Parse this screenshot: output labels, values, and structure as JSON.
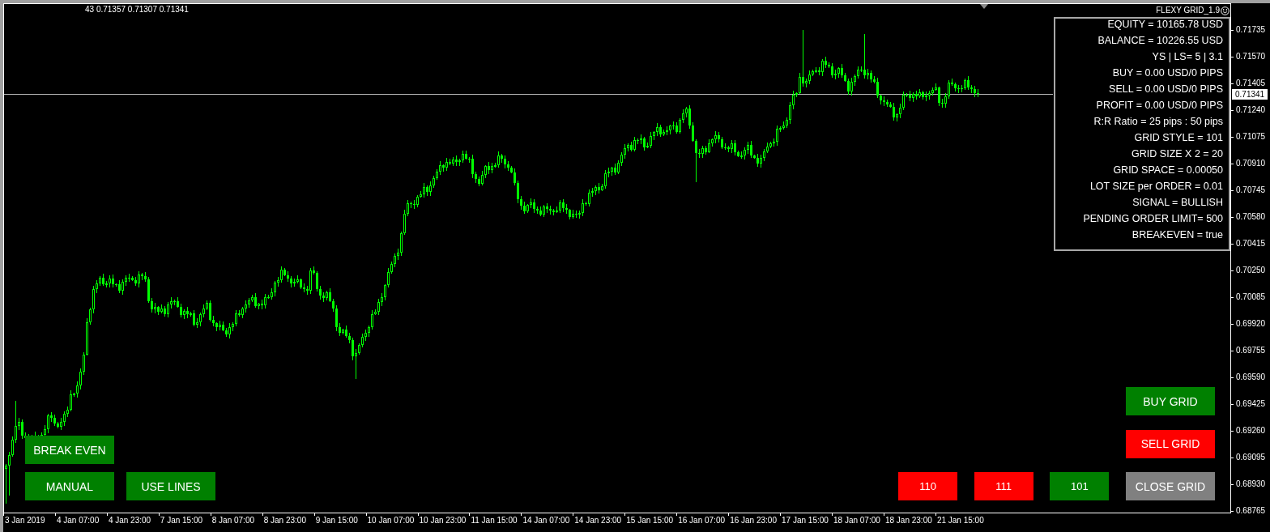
{
  "chart": {
    "ohlc_text": "43 0.71357 0.71307 0.71341",
    "expert_label": "FLEXY GRID_1.9",
    "current_price": "0.71341",
    "price_axis": [
      "0.71735",
      "0.71570",
      "0.71405",
      "0.71240",
      "0.71075",
      "0.70910",
      "0.70745",
      "0.70580",
      "0.70415",
      "0.70250",
      "0.70085",
      "0.69920",
      "0.69755",
      "0.69590",
      "0.69425",
      "0.69260",
      "0.69095",
      "0.68930",
      "0.68765"
    ],
    "time_axis": [
      "3 Jan 2019",
      "4 Jan 07:00",
      "4 Jan 23:00",
      "7 Jan 15:00",
      "8 Jan 07:00",
      "8 Jan 23:00",
      "9 Jan 15:00",
      "10 Jan 07:00",
      "10 Jan 23:00",
      "11 Jan 15:00",
      "14 Jan 07:00",
      "14 Jan 23:00",
      "15 Jan 15:00",
      "16 Jan 07:00",
      "16 Jan 23:00",
      "17 Jan 15:00",
      "18 Jan 07:00",
      "18 Jan 23:00",
      "21 Jan 15:00"
    ]
  },
  "info_panel": {
    "lines": [
      "EQUITY = 10165.78 USD",
      "BALANCE = 10226.55 USD",
      "YS | LS= 5 | 3.1",
      "BUY = 0.00 USD/0 PIPS",
      "SELL = 0.00 USD/0 PIPS",
      "PROFIT = 0.00 USD/0 PIPS",
      "R:R Ratio = 25 pips : 50 pips",
      "GRID STYLE = 101",
      "GRID SIZE X 2 = 20",
      "GRID SPACE = 0.00050",
      "LOT SIZE per ORDER = 0.01",
      "SIGNAL = BULLISH",
      "PENDING ORDER LIMIT= 500",
      "BREAKEVEN = true"
    ]
  },
  "toggle_buttons": [
    {
      "label": "BREAK EVEN",
      "on": true
    },
    {
      "label": "MANUAL",
      "on": true
    },
    {
      "label": "USE LINES",
      "on": true
    }
  ],
  "grid_style_buttons": [
    {
      "label": "110",
      "selected": false
    },
    {
      "label": "111",
      "selected": false
    },
    {
      "label": "101",
      "selected": true
    }
  ],
  "action_buttons": [
    {
      "label": "BUY GRID",
      "color": "#008000"
    },
    {
      "label": "SELL GRID",
      "color": "#ff0000"
    },
    {
      "label": "CLOSE GRID",
      "color": "#808080"
    }
  ]
}
